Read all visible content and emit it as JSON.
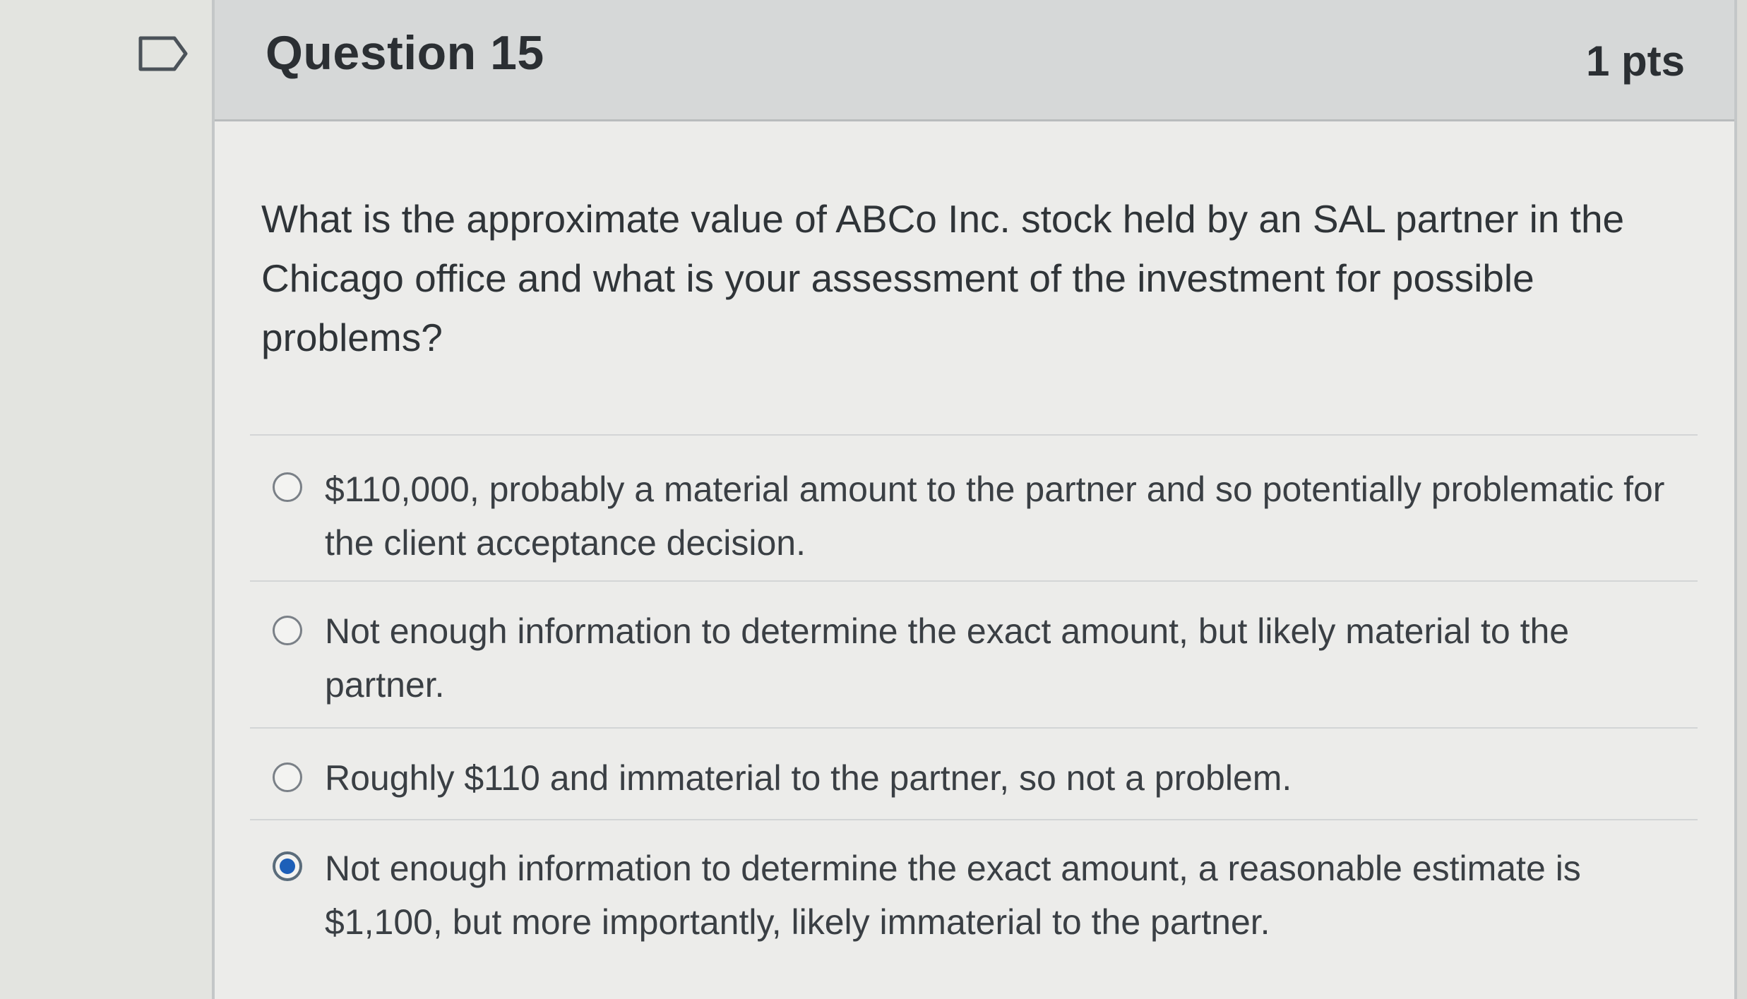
{
  "question": {
    "title": "Question 15",
    "points": "1 pts",
    "text": "What is the approximate value of ABCo Inc. stock held by an SAL partner in the Chicago office and what is your assessment of the investment for possible problems?"
  },
  "answers": [
    {
      "label": "$110,000, probably a material amount to the partner and so potentially problematic for the client acceptance decision.",
      "selected": false
    },
    {
      "label": "Not enough information to determine the exact amount, but likely material to the partner.",
      "selected": false
    },
    {
      "label": "Roughly $110 and immaterial to the partner, so not a problem.",
      "selected": false
    },
    {
      "label": "Not enough information to determine the exact amount, a reasonable estimate is $1,100, but more importantly, likely immaterial to the partner.",
      "selected": true
    }
  ],
  "icons": {
    "flag": "bookmark-flag-icon",
    "radio": "radio-button-icon"
  },
  "colors": {
    "header_bg": "#d6d8d8",
    "card_bg": "#ececea",
    "selected_radio": "#1d5fb8"
  }
}
